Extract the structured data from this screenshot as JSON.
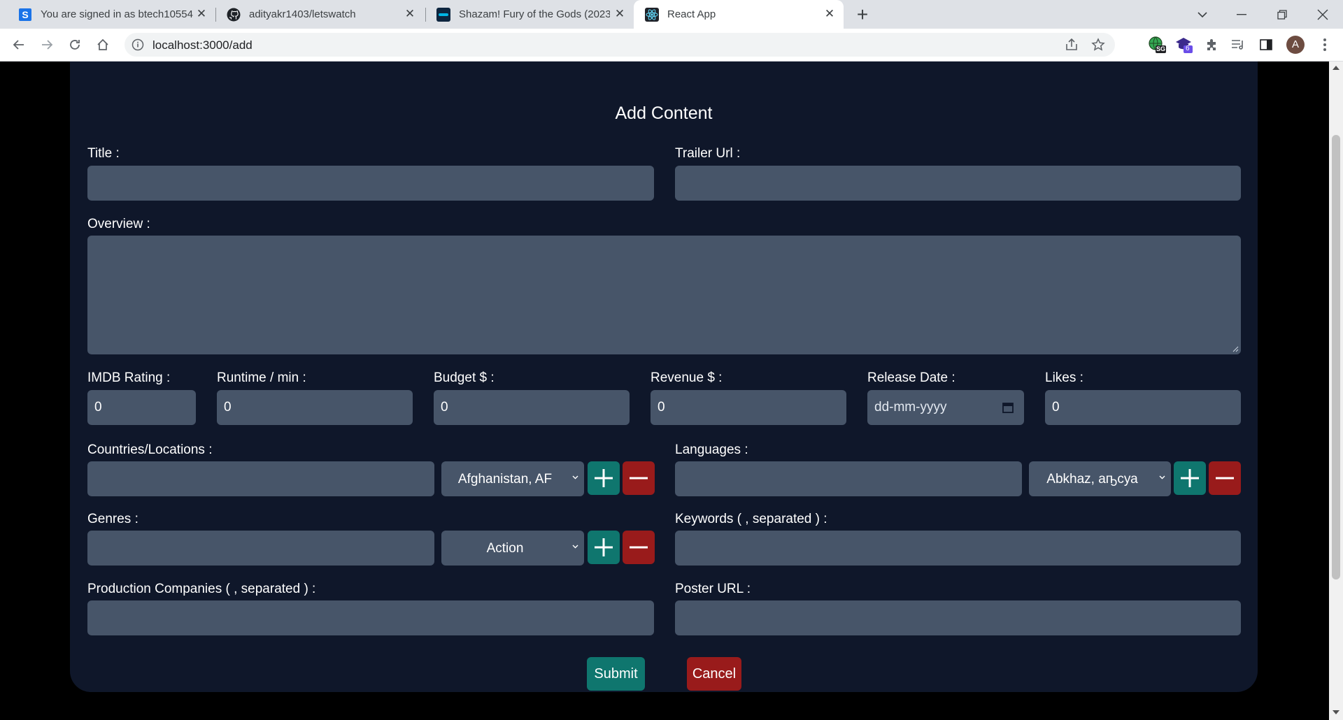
{
  "browser": {
    "tabs": [
      {
        "title": "You are signed in as btech10554",
        "icon": "s-letter-icon"
      },
      {
        "title": "adityakr1403/letswatch",
        "icon": "github-icon"
      },
      {
        "title": "Shazam! Fury of the Gods (2023)",
        "icon": "movie-site-icon"
      },
      {
        "title": "React App",
        "icon": "react-icon"
      }
    ],
    "url": "localhost:3000/add",
    "profile_initial": "A",
    "ext_badge_1": "SG",
    "ext_badge_2": "6"
  },
  "form": {
    "heading": "Add Content",
    "labels": {
      "title": "Title :",
      "trailer": "Trailer Url :",
      "overview": "Overview :",
      "imdb": "IMDB Rating :",
      "runtime": "Runtime / min :",
      "budget": "Budget $ :",
      "revenue": "Revenue $ :",
      "release": "Release Date :",
      "likes": "Likes :",
      "countries": "Countries/Locations :",
      "languages": "Languages :",
      "genres": "Genres :",
      "keywords": "Keywords ( , separated ) :",
      "companies": "Production Companies ( , separated ) :",
      "poster": "Poster URL :"
    },
    "values": {
      "imdb": "0",
      "runtime": "0",
      "budget": "0",
      "revenue": "0",
      "release_placeholder": "dd-mm-yyyy",
      "likes": "0"
    },
    "selects": {
      "country": "Afghanistan, AF",
      "language": "Abkhaz, аҧсуа",
      "genre": "Action"
    },
    "buttons": {
      "submit": "Submit",
      "cancel": "Cancel"
    }
  },
  "colors": {
    "card_bg": "#0f172a",
    "field_bg": "#475569",
    "add_green": "#0f766e",
    "remove_red": "#991b1b"
  }
}
